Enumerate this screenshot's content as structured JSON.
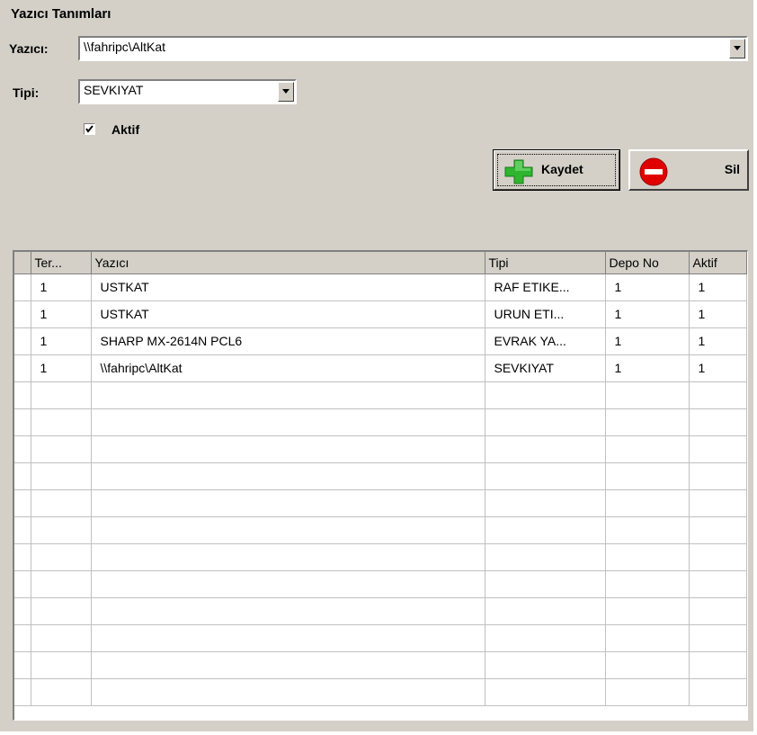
{
  "group_title": "Yazıcı Tanımları",
  "form": {
    "printer_label": "Yazıcı:",
    "printer_value": "\\\\fahripc\\AltKat",
    "type_label": "Tipi:",
    "type_value": "SEVKIYAT",
    "active_label": "Aktif",
    "active_checked": true
  },
  "buttons": {
    "save_label": "Kaydet",
    "delete_label": "Sil"
  },
  "colors": {
    "panel": "#d4d0c8",
    "save_icon": "#2fb52f",
    "delete_icon": "#e00000"
  },
  "grid": {
    "columns": [
      "Ter...",
      "Yazıcı",
      "Tipi",
      "Depo No",
      "Aktif"
    ],
    "rows": [
      [
        "1",
        "USTKAT",
        "RAF ETIKE...",
        "1",
        "1"
      ],
      [
        "1",
        "USTKAT",
        "URUN ETI...",
        "1",
        "1"
      ],
      [
        "1",
        "SHARP MX-2614N PCL6",
        "EVRAK YA...",
        "1",
        "1"
      ],
      [
        "1",
        "\\\\fahripc\\AltKat",
        "SEVKIYAT",
        "1",
        "1"
      ]
    ]
  }
}
